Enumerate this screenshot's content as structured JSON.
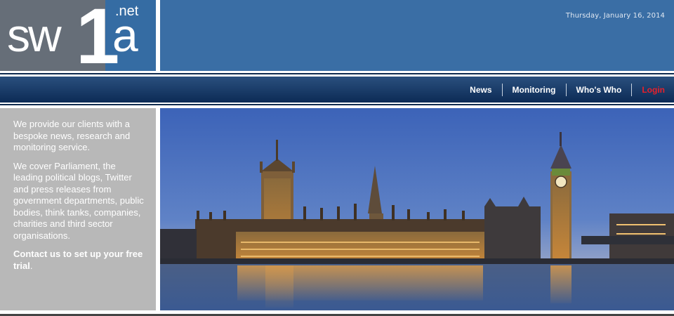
{
  "header": {
    "logo": {
      "sw": "sw",
      "one": "1",
      "a": "a",
      "tld": ".net"
    },
    "date": "Thursday, January 16, 2014"
  },
  "nav": {
    "items": [
      {
        "label": "News"
      },
      {
        "label": "Monitoring"
      },
      {
        "label": "Who's Who"
      },
      {
        "label": "Login"
      }
    ]
  },
  "intro": {
    "paragraph1": "We provide our clients with a bespoke news, research and monitoring service.",
    "paragraph2": "We cover Parliament, the leading political blogs, Twitter and press releases from government departments, public bodies, think tanks, companies, charities and third sector organisations.",
    "cta_bold": "Contact us to set up your free trial",
    "cta_end": "."
  },
  "colors": {
    "logo_grey": "#666e78",
    "brand_blue": "#3a6ea5",
    "nav_navy": "#0c2b55",
    "login_red": "#e8202a",
    "sidebar_grey": "#b8b8b8"
  },
  "hero": {
    "image": "houses-of-parliament-dusk-photo"
  }
}
